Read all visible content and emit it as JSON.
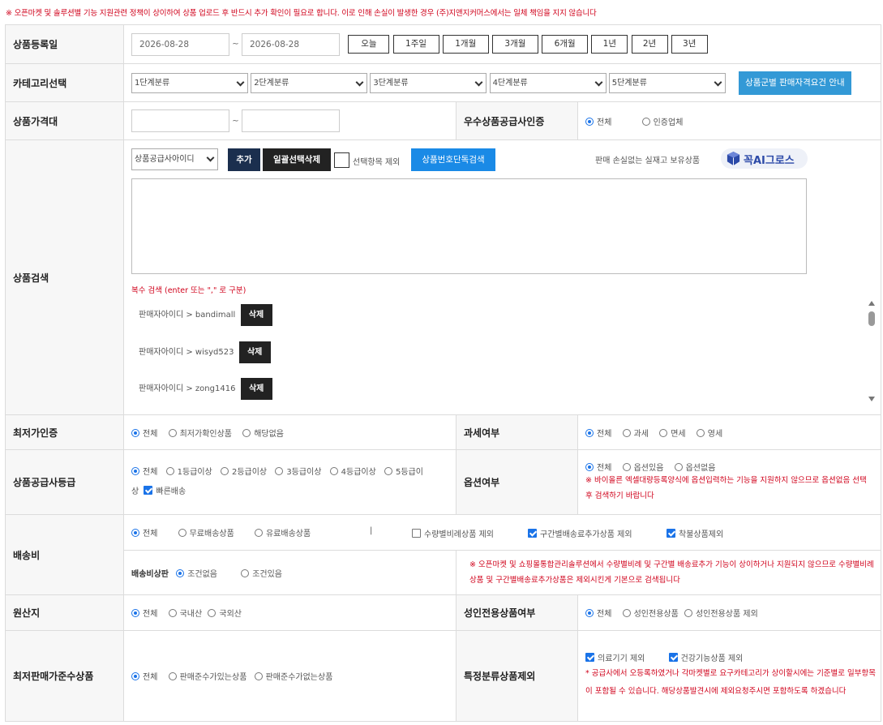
{
  "notice": "※ 오픈마켓 및 솔루션별 기능 지원관련 정책이 상이하여 상품 업로드 후 반드시 추가 확인이 필요로 합니다. 이로 인해 손실이 발생한 경우 (주)지앤지커머스에서는 일체 책임을 지지 않습니다",
  "date": {
    "label": "상품등록일",
    "from": "2026-08-28",
    "to": "2026-08-28",
    "separator": "~",
    "periods": [
      "오늘",
      "1주일",
      "1개월",
      "3개월",
      "6개월",
      "1년",
      "2년",
      "3년"
    ]
  },
  "category": {
    "label": "카테고리선택",
    "selects": [
      "1단계분류",
      "2단계분류",
      "3단계분류",
      "4단계분류",
      "5단계분류"
    ],
    "guide_button": "상품군별 판매자격요건 안내"
  },
  "price": {
    "label": "상품가격대",
    "min": "",
    "max": "",
    "separator": "~"
  },
  "excellent": {
    "label": "우수상품공급사인증",
    "options": [
      "전체",
      "인증업체"
    ]
  },
  "search": {
    "label": "상품검색",
    "type_select": "상품공급사아이디",
    "add": "추가",
    "delete_all": "일괄선택삭제",
    "exclude_selected": "선택항목 제외",
    "number_search": "상품번호단독검색",
    "promo_text": "판매 손실없는 실재고 보유상품",
    "promo_logo": "꼭AI그로스",
    "textarea": "",
    "hint": "복수 검색 (enter 또는 \",\" 로 구분)",
    "items": [
      {
        "text": "판매자아이디 > bandimall",
        "btn": "삭제"
      },
      {
        "text": "판매자아이디 > wisyd523",
        "btn": "삭제"
      },
      {
        "text": "판매자아이디 > zong1416",
        "btn": "삭제"
      }
    ]
  },
  "lowest": {
    "label": "최저가인증",
    "options": [
      "전체",
      "최저가확인상품",
      "해당없음"
    ]
  },
  "tax": {
    "label": "과세여부",
    "options": [
      "전체",
      "과세",
      "면세",
      "영세"
    ]
  },
  "grade": {
    "label": "상품공급사등급",
    "options": [
      "전체",
      "1등급이상",
      "2등급이상",
      "3등급이상",
      "4등급이상",
      "5등급이"
    ],
    "wrap": "상",
    "fast": "빠른배송"
  },
  "option": {
    "label": "옵션여부",
    "options": [
      "전체",
      "옵션있음",
      "옵션없음"
    ],
    "note": "※ 바이올른 엑셀대량등록양식에 옵션입력하는 기능을 지원하지 않으므로 옵션없음 선택 후 검색하기 바랍니다"
  },
  "shipping": {
    "label": "배송비",
    "options": [
      "전체",
      "무료배송상품",
      "유료배송상품"
    ],
    "divider": "|",
    "checks": [
      "수량별비례상품 제외",
      "구간별배송료추가상품 제외",
      "착불상품제외"
    ],
    "cond_label": "배송비상판",
    "cond_options": [
      "조건없음",
      "조건있음"
    ],
    "note": "※ 오픈마켓 및 쇼핑몰통합관리솔루션에서 수량별비례 및 구간별 배송료추가 기능이 상이하거나 지원되지 않으므로 수량별비례상품 및 구간별배송료추가상품은 제외시킨게 기본으로 검색됩니다"
  },
  "origin": {
    "label": "원산지",
    "options": [
      "전체",
      "국내산",
      "국외산"
    ]
  },
  "adult": {
    "label": "성인전용상품여부",
    "options": [
      "전체",
      "성인전용상품",
      "성인전용상품 제외"
    ]
  },
  "minprice": {
    "label": "최저판매가준수상품",
    "options": [
      "전체",
      "판매준수가있는상품",
      "판매준수가없는상품"
    ]
  },
  "special": {
    "label": "특정분류상품제외",
    "checks": [
      "의료기기 제외",
      "건강기능상품 제외"
    ],
    "note": "* 공급사에서 오등록하였거나 각마켓별로 요구카테고리가 상이할시에는 기준별로 일부항목이 포함될 수 있습니다. 해당상품발견시에 제외요청주시면 포함하도록 하겠습니다"
  }
}
